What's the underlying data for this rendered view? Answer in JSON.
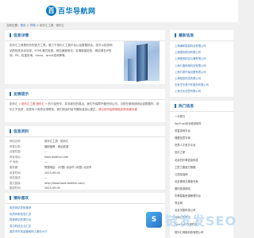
{
  "logo": {
    "mark": "百",
    "text": "百华导航网"
  },
  "crumb": {
    "home": "当前位置：",
    "a1": "首页",
    "sep": " > ",
    "a2": "货物",
    "sep2": " > ",
    "current": "铂乐汇工具 · 铂乐汇"
  },
  "intro": {
    "title": "信息详情",
    "text": "铂乐汇工具是铂乐的官方工具，致力于铂乐汇工具平台以及数据综合。还可以检查网站的相关优化信息，HTML格式检测、网站速度测试、友情链接检查、网站域名IP查询、PR、权重查询、alexa、whois查询等等。"
  },
  "notice": {
    "title": "友情提示",
    "pre": "铂乐汇 » ",
    "link": "铂乐汇工具 铂乐汇",
    "post": " » 的介绍完毕，并非我们的观点，我们不保障不做任何认可，当您在使用该网址或数据时，铂乐汇不负责，如您本人有异议请联系，我们将及时给予删除或加以更正。",
    "red": "请以访问后的网站实际页面为准"
  },
  "info": {
    "title": "信息资料",
    "rows": [
      {
        "k": "网站名称：",
        "v": "铂乐汇工具 · 铂乐汇"
      },
      {
        "k": "所属分类：",
        "v": "福利推荐 · 网站收录"
      },
      {
        "k": "百度权重：",
        "v": "—"
      },
      {
        "k": "网址地址：",
        "v": "tools.bolehui.com"
      },
      {
        "k": "IP 地址：",
        "v": "—"
      },
      {
        "k": "服务器：",
        "v": "所属地区：(中国) 北京市 (中国) 北京市"
      },
      {
        "k": "收录时间：",
        "v": "2023-09-04"
      },
      {
        "k": "网站描述：",
        "v": "—"
      },
      {
        "k": "直达链接：",
        "v": "http://www.tools.bolehui.com/"
      },
      {
        "k": "更新时间：",
        "v": "2023-09-04"
      }
    ]
  },
  "related": {
    "title": "猜你喜欢",
    "items": [
      "相关网站导航推荐",
      "优质商家信息汇总",
      "推荐网站资源平台",
      "前沿科技企业汇总",
      "重庆市市场监管局网上服务大厅"
    ]
  },
  "side1": {
    "title": "最新信息",
    "items": [
      "上海瀚和智能科技有限公司",
      "上海国际物流有限公司",
      "上海爱信精密仪器有限公司",
      "上海久隆网络科技有限公司",
      "上海万振环保设备有限公司",
      "上海易辰科技有限公司",
      "石家庄华美汽车服务有限公司",
      "上海文化创意有限公司"
    ]
  },
  "side2": {
    "title": "热门信息",
    "items": [
      "一分钟日",
      "SecTrust安全检测软件",
      "安智游戏平台",
      "搜藏创意字体",
      "世界人才官方平台",
      "迈乐之家",
      "北京四叶草信息科技",
      "工匠之路官方旗舰",
      "江西加油网",
      "北京黄岗五粮液专卖",
      "爱情旅游网站",
      "华美智能资源管理平台",
      "同业网",
      "北京天数科技公司",
      "商标注册查询",
      "Geektutu在线教程",
      "铂乐汇网络科技有限公司"
    ]
  },
  "watermark": {
    "icon": "S",
    "text": "链发发SEO"
  }
}
